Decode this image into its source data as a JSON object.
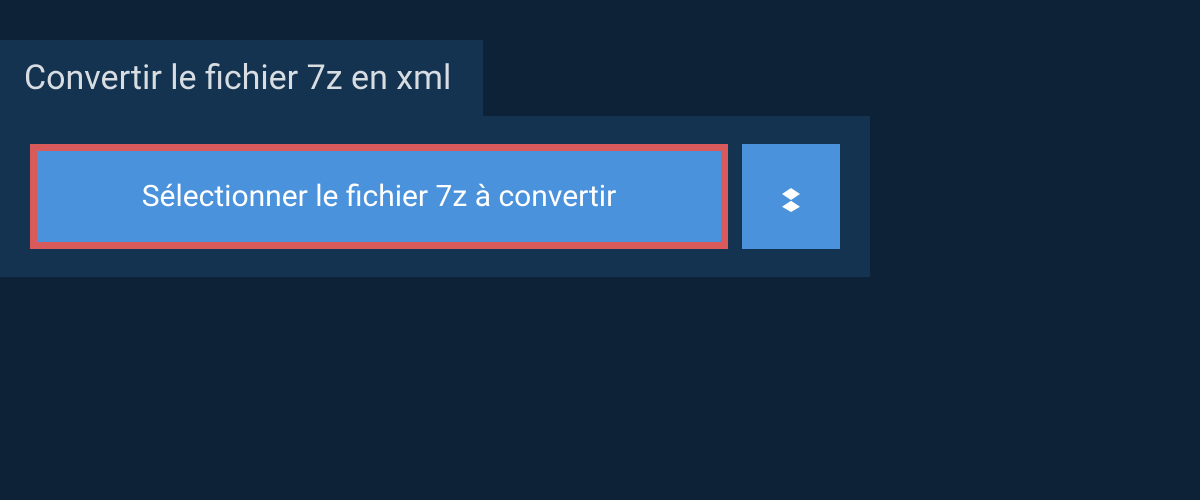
{
  "header": {
    "title": "Convertir le fichier 7z en xml"
  },
  "actions": {
    "select_file_label": "Sélectionner le fichier 7z à convertir",
    "dropbox_icon_name": "dropbox"
  },
  "colors": {
    "background": "#0d2236",
    "panel": "#143351",
    "button": "#4a92db",
    "highlight_border": "#d85a5a",
    "text_light": "#d8dde2",
    "text_white": "#ffffff"
  }
}
